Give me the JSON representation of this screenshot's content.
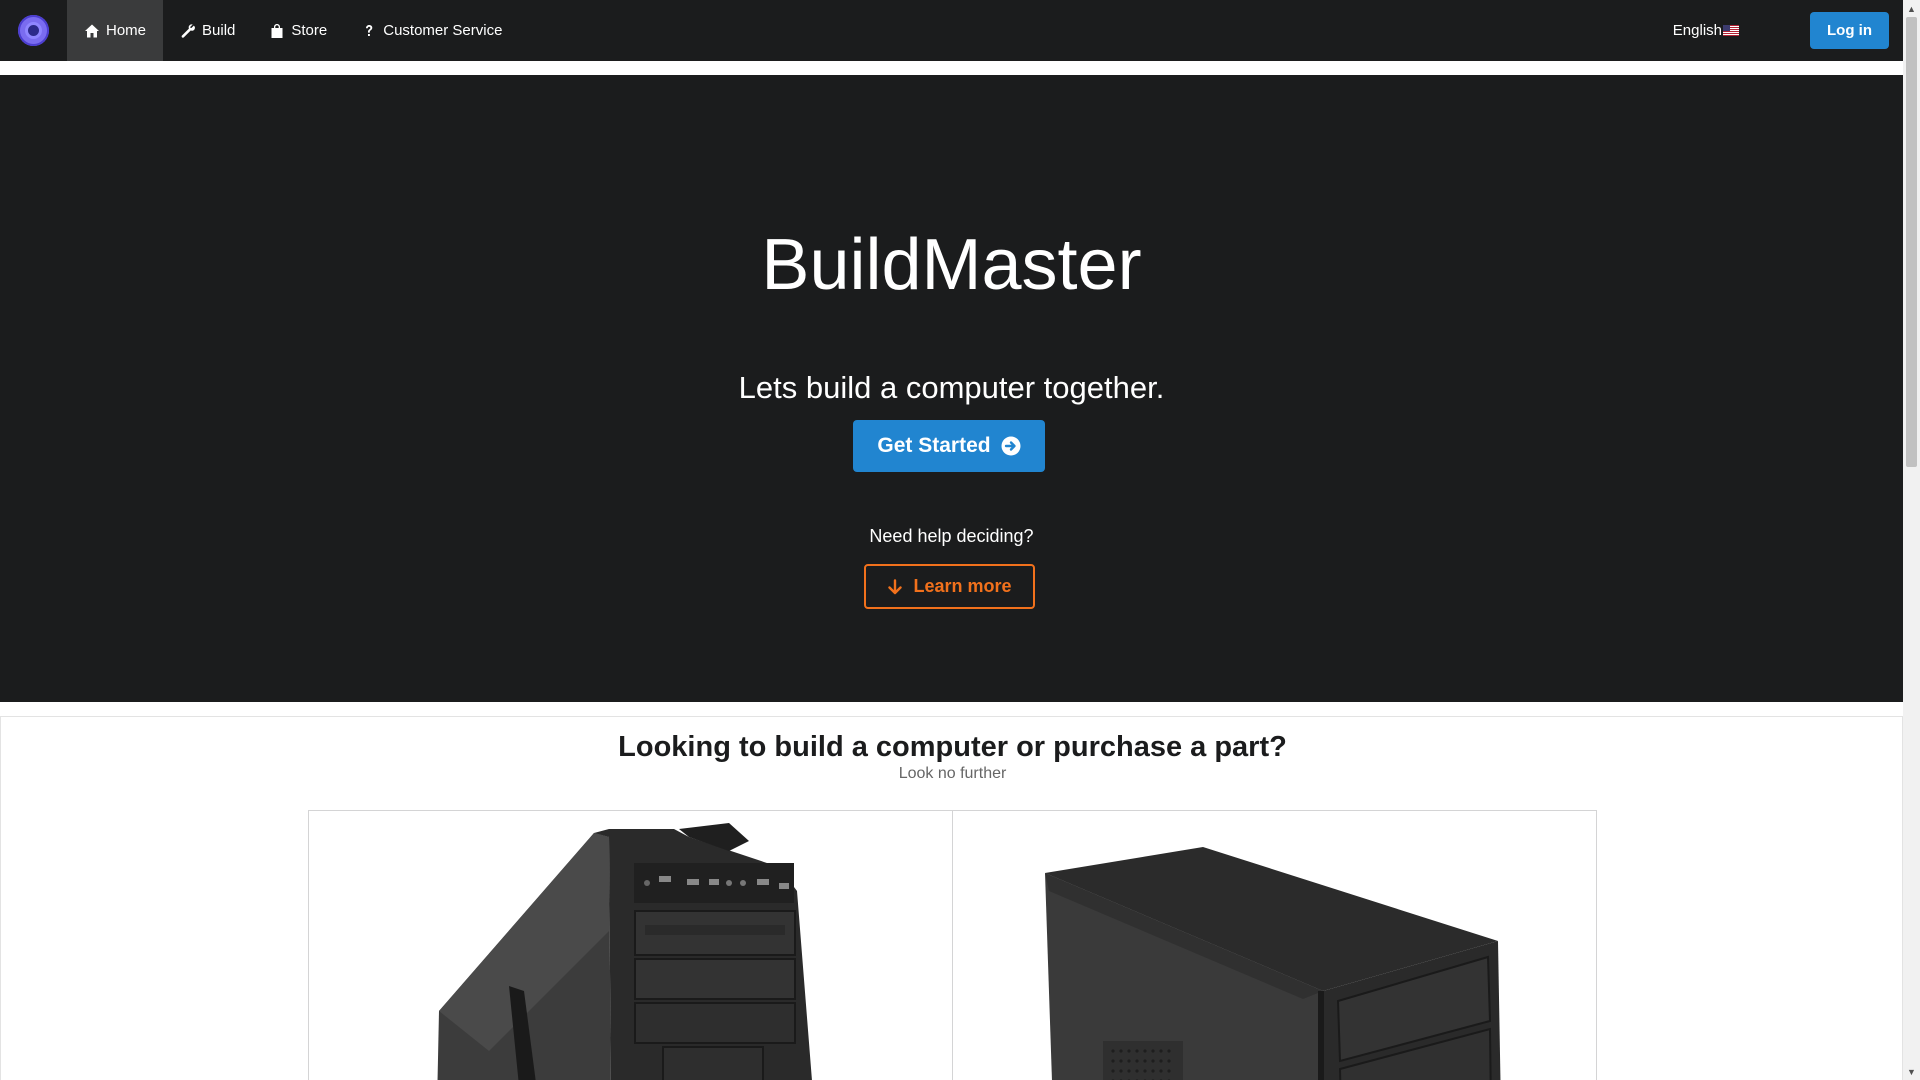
{
  "nav": {
    "items": [
      {
        "label": "Home",
        "icon": "home-icon",
        "active": true
      },
      {
        "label": "Build",
        "icon": "wrench-icon",
        "active": false
      },
      {
        "label": "Store",
        "icon": "shopping-bag-icon",
        "active": false
      },
      {
        "label": "Customer Service",
        "icon": "question-icon",
        "active": false
      }
    ],
    "language": "English",
    "login_label": "Log in"
  },
  "hero": {
    "title": "BuildMaster",
    "subtitle": "Lets build a computer together.",
    "cta_label": "Get Started",
    "help_text": "Need help deciding?",
    "learn_more_label": "Learn more"
  },
  "section": {
    "title": "Looking to build a computer or purchase a part?",
    "subtitle": "Look no further"
  },
  "colors": {
    "dark_bg": "#1b1c1d",
    "primary_blue": "#2185d0",
    "accent_orange": "#f2711c",
    "logo_purple": "#7a6cf0"
  }
}
